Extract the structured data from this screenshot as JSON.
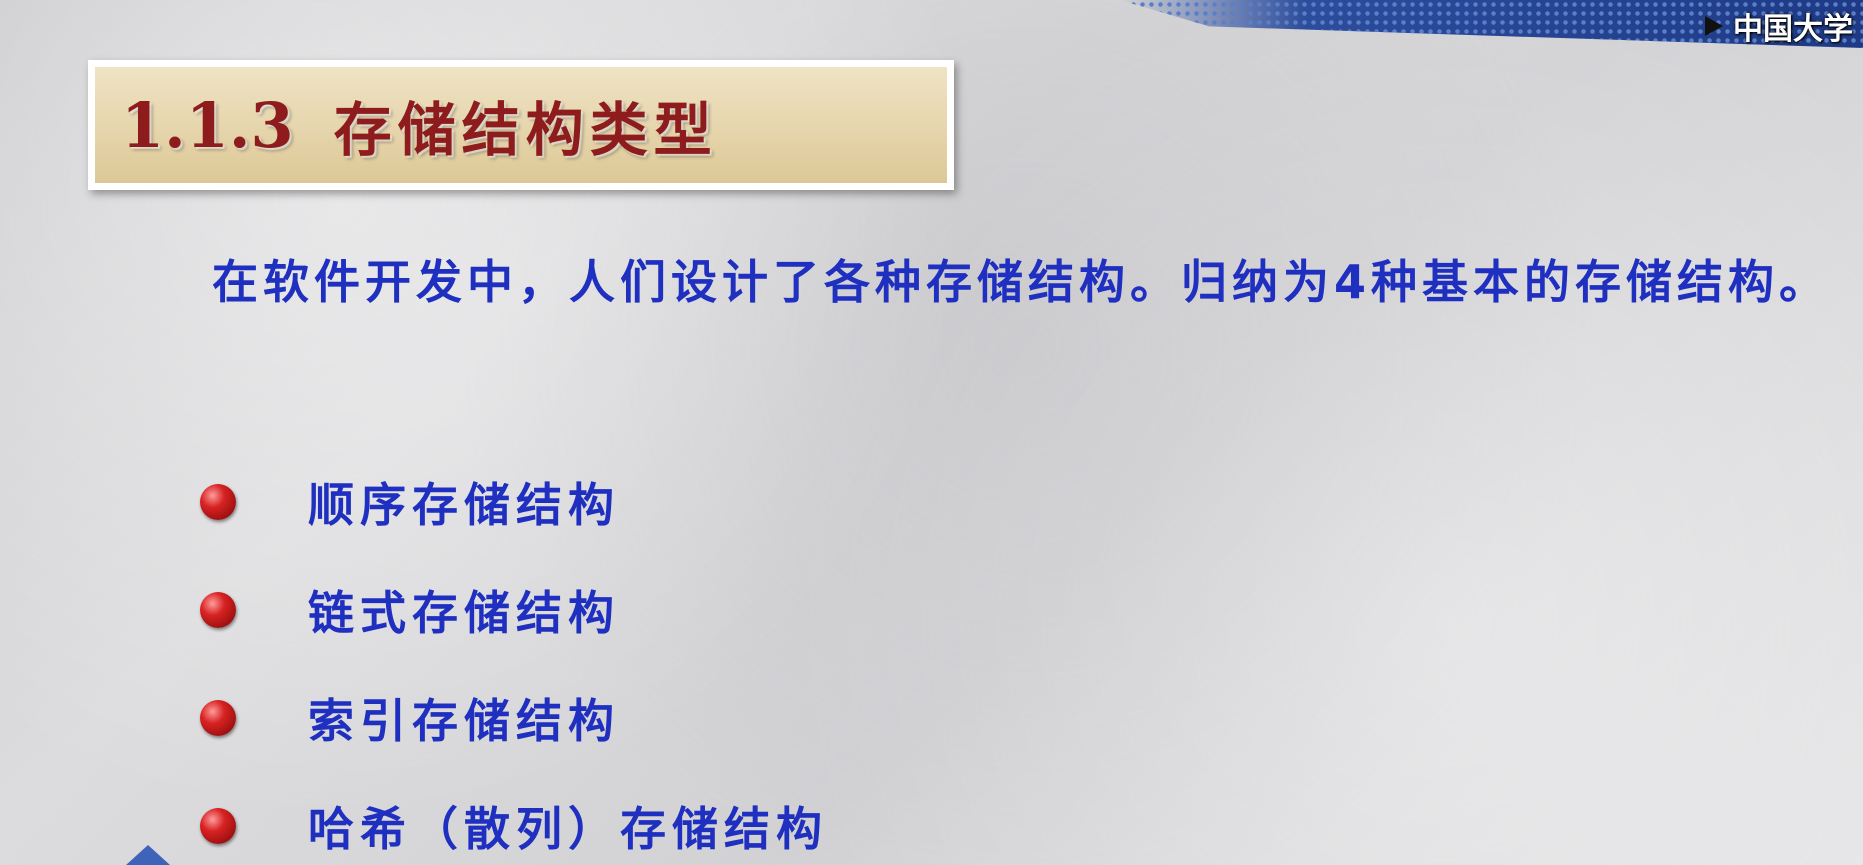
{
  "watermark": {
    "text": "中国大学"
  },
  "title": {
    "number": "1.1.3",
    "text": "存储结构类型"
  },
  "intro": {
    "text": "在软件开发中，人们设计了各种存储结构。归纳为4种基本的存储结构。"
  },
  "bullets": [
    {
      "label": "顺序存储结构"
    },
    {
      "label": "链式存储结构"
    },
    {
      "label": "索引存储结构"
    },
    {
      "label": "哈希（散列）存储结构"
    }
  ],
  "colors": {
    "title_text": "#8e1c1c",
    "body_text": "#1f2fc0",
    "bullet": "#d82222",
    "title_box_bg": "#e6d5ac"
  }
}
